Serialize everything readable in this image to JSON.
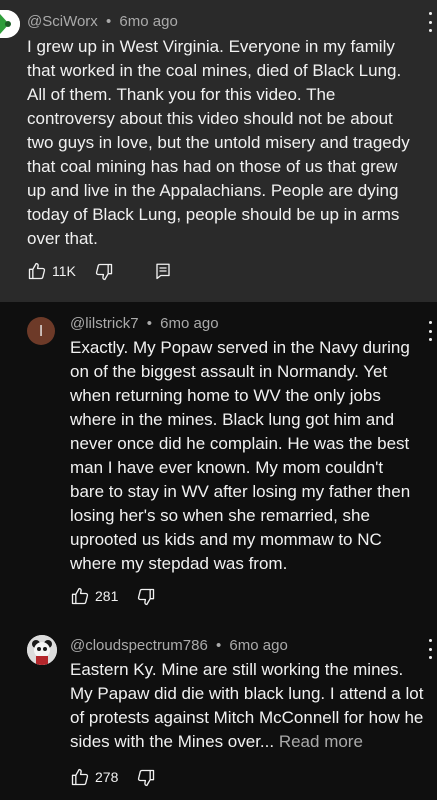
{
  "comments": [
    {
      "author": "@SciWorx",
      "time": "6mo ago",
      "text": "I grew up in West Virginia. Everyone in my family that worked in the coal mines, died of Black Lung. All of them. Thank you for this video. The controversy about this video should not be about two guys in love, but the untold misery and tragedy that coal mining has had on those of us that grew up and live in the Appalachians. People are dying today of Black Lung, people should be up in arms over that.",
      "likes": "11K"
    },
    {
      "author": "@lilstrick7",
      "time": "6mo ago",
      "avatar_letter": "l",
      "text": "Exactly. My Popaw served in the Navy during on of the biggest assault in Normandy. Yet when returning home to WV the only jobs where in the mines. Black lung got him and never once did he complain. He was the best man I have ever known. My mom couldn't bare to stay in WV after losing my father then losing her's so when she remarried, she uprooted us kids and my mommaw to NC where my stepdad was from.",
      "likes": "281"
    },
    {
      "author": "@cloudspectrum786",
      "time": "6mo ago",
      "text": "Eastern Ky. Mine are still working the mines. My Papaw  did die with black lung. I attend a lot of  protests against  Mitch McConnell for how he sides with the Mines over...",
      "read_more": "Read more",
      "likes": "278"
    }
  ],
  "separator": "•",
  "colors": {
    "background": "#0f0f0f",
    "highlight": "#2a2a2a",
    "secondary_text": "#aaaaaa",
    "avatar_letter_bg": "#6d3a28"
  }
}
